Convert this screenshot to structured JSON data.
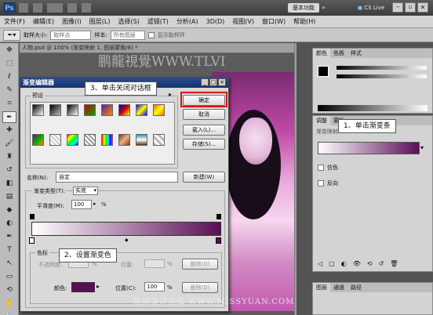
{
  "app": {
    "logo": "Ps",
    "workspace_button": "基本功能",
    "cs_live": "CS Live"
  },
  "menu": [
    "文件(F)",
    "编辑(E)",
    "图像(I)",
    "图层(L)",
    "选择(S)",
    "滤镜(T)",
    "分析(A)",
    "3D(D)",
    "视图(V)",
    "窗口(W)",
    "帮助(H)"
  ],
  "options_bar": {
    "sample_size_label": "取样大小:",
    "sample_size_value": "取样点",
    "sample_label": "样本:",
    "sample_value": "所有图层",
    "show_ring_label": "显示取样环"
  },
  "document": {
    "tab_title": "人物.psd @ 100% (渐变映射 1, 图层蒙版/8) *"
  },
  "watermark_top": "鹏龍視覺WWW.TLVI",
  "watermark_bottom": "思缘设计论坛 WWW.MISSYUAN.COM",
  "dialog": {
    "title": "渐变编辑器",
    "presets_label": "预设",
    "ok_label": "确定",
    "cancel_label": "取消",
    "load_label": "载入(L)...",
    "save_label": "存储(S)...",
    "name_label": "名称(N):",
    "name_value": "自定",
    "new_label": "新建(W)",
    "gradient_type_label": "渐变类型(T):",
    "gradient_type_value": "实底",
    "smoothness_label": "平滑度(M):",
    "smoothness_value": "100",
    "smoothness_unit": "%",
    "color_stops_label": "色标",
    "opacity_label": "不透明度:",
    "opacity_unit": "%",
    "location_label_top": "位置:",
    "delete_label_top": "删除(D)",
    "color_label": "颜色:",
    "location_label": "位置(C):",
    "location_value": "100",
    "location_unit": "%",
    "delete_label": "删除(D)",
    "stop_color": "#5a0e55"
  },
  "right_panels": {
    "color_tabs": [
      "颜色",
      "色板",
      "样式"
    ],
    "adjust_tabs": [
      "调整",
      "蒙版"
    ],
    "adjust_title": "渐变映射",
    "dither_label": "仿色",
    "reverse_label": "反向",
    "layers_tabs": [
      "图层",
      "通道",
      "路径"
    ]
  },
  "callouts": {
    "step1": "1、单击渐变条",
    "step2": "2、设置渐变色",
    "step3": "3、单击关闭对话框"
  },
  "colors": {
    "gradient_start": "#ffffff",
    "gradient_end": "#5a0e55",
    "title_blue": "#1a3a7e",
    "highlight_red": "#e01010"
  }
}
